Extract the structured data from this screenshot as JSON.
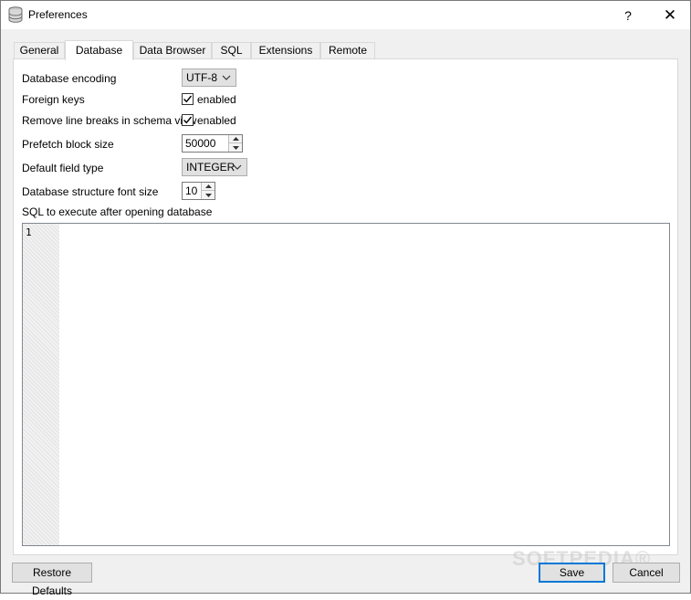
{
  "window": {
    "title": "Preferences",
    "help_label": "?",
    "close_label": "✕"
  },
  "tabs": [
    {
      "label": "General"
    },
    {
      "label": "Database"
    },
    {
      "label": "Data Browser"
    },
    {
      "label": "SQL"
    },
    {
      "label": "Extensions"
    },
    {
      "label": "Remote"
    }
  ],
  "active_tab": "Database",
  "form": {
    "encoding": {
      "label": "Database encoding",
      "value": "UTF-8"
    },
    "foreign_keys": {
      "label": "Foreign keys",
      "checked": true,
      "check_label": "enabled"
    },
    "line_breaks": {
      "label": "Remove line breaks in schema view",
      "checked": true,
      "check_label": "enabled"
    },
    "prefetch": {
      "label": "Prefetch block size",
      "value": "50000"
    },
    "field_type": {
      "label": "Default field type",
      "value": "INTEGER"
    },
    "font_size": {
      "label": "Database structure font size",
      "value": "10"
    },
    "sql_after_open": {
      "label": "SQL to execute after opening database",
      "line_number": "1",
      "content": ""
    }
  },
  "buttons": {
    "restore": "Restore Defaults",
    "save": "Save",
    "cancel": "Cancel"
  },
  "watermark": "SOFTPEDIA®",
  "colors": {
    "default_button_border": "#0078d7",
    "panel_bg": "#ffffff",
    "dialog_bg": "#f0f0f0"
  }
}
